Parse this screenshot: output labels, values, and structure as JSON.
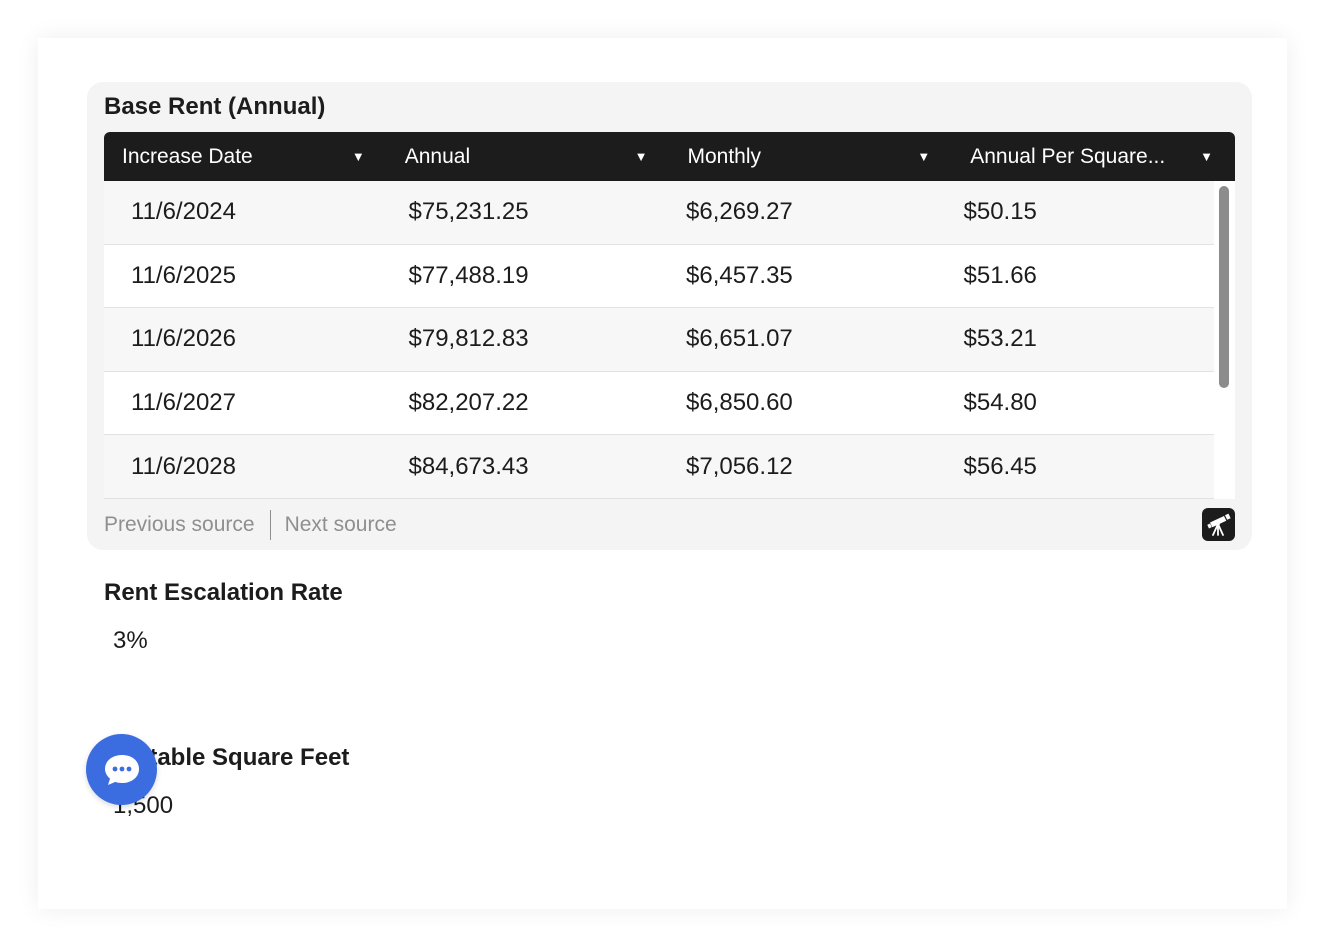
{
  "base_rent": {
    "title": "Base Rent (Annual)",
    "columns": [
      {
        "label": "Increase Date"
      },
      {
        "label": "Annual"
      },
      {
        "label": "Monthly"
      },
      {
        "label": "Annual Per Square..."
      }
    ],
    "rows": [
      [
        "11/6/2024",
        "$75,231.25",
        "$6,269.27",
        "$50.15"
      ],
      [
        "11/6/2025",
        "$77,488.19",
        "$6,457.35",
        "$51.66"
      ],
      [
        "11/6/2026",
        "$79,812.83",
        "$6,651.07",
        "$53.21"
      ],
      [
        "11/6/2027",
        "$82,207.22",
        "$6,850.60",
        "$54.80"
      ],
      [
        "11/6/2028",
        "$84,673.43",
        "$7,056.12",
        "$56.45"
      ]
    ],
    "previous_source_label": "Previous source",
    "next_source_label": "Next source",
    "scope_icon": "telescope-icon"
  },
  "rent_escalation": {
    "label": "Rent Escalation Rate",
    "value": "3%"
  },
  "rentable_area": {
    "label": "Rentable Square Feet",
    "value": "1,500"
  },
  "chat": {
    "icon": "chat-dots-icon",
    "color": "#3b6de0"
  },
  "colors": {
    "header_bg": "#1c1c1c",
    "panel_bg": "#f4f4f4",
    "muted_text": "#8f8f8f"
  }
}
